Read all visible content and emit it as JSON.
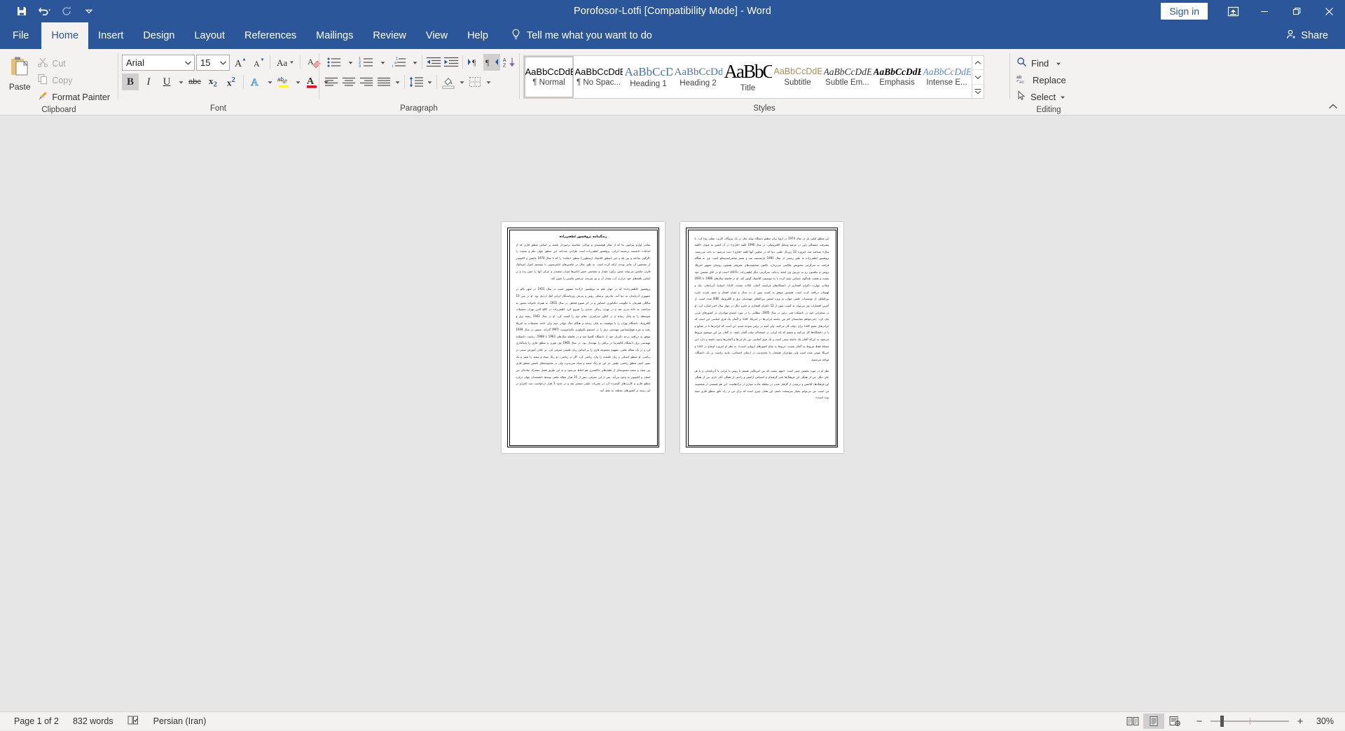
{
  "window": {
    "title": "Porofosor-Lotfi [Compatibility Mode]  -  Word",
    "sign_in": "Sign in"
  },
  "quick_access": {
    "save": "Save",
    "undo": "Undo",
    "redo": "Redo",
    "customize": "Customize Quick Access Toolbar"
  },
  "tabs": [
    {
      "label": "File",
      "active": false
    },
    {
      "label": "Home",
      "active": true
    },
    {
      "label": "Insert",
      "active": false
    },
    {
      "label": "Design",
      "active": false
    },
    {
      "label": "Layout",
      "active": false
    },
    {
      "label": "References",
      "active": false
    },
    {
      "label": "Mailings",
      "active": false
    },
    {
      "label": "Review",
      "active": false
    },
    {
      "label": "View",
      "active": false
    },
    {
      "label": "Help",
      "active": false
    }
  ],
  "tell_me": "Tell me what you want to do",
  "share": "Share",
  "ribbon": {
    "clipboard": {
      "label": "Clipboard",
      "paste": "Paste",
      "cut": "Cut",
      "copy": "Copy",
      "format_painter": "Format Painter"
    },
    "font": {
      "label": "Font",
      "font_name": "Arial",
      "font_size": "15",
      "grow_font": "Grow Font",
      "shrink_font": "Shrink Font",
      "change_case": "Change Case",
      "clear_formatting": "Clear All Formatting",
      "bold": "B",
      "italic": "I",
      "underline": "U",
      "strikethrough": "abc",
      "subscript": "x₂",
      "superscript": "x²",
      "text_effects": "Text Effects and Typography",
      "highlight": "Text Highlight Color",
      "font_color": "Font Color"
    },
    "paragraph": {
      "label": "Paragraph",
      "bullets": "Bullets",
      "numbering": "Numbering",
      "multilevel": "Multilevel List",
      "decrease_indent": "Decrease Indent",
      "increase_indent": "Increase Indent",
      "ltr": "Left-to-Right Text Direction",
      "rtl": "Right-to-Left Text Direction",
      "sort": "Sort",
      "show_marks": "Show/Hide ¶",
      "align_left": "Align Left",
      "align_center": "Center",
      "align_right": "Align Right",
      "justify": "Justify",
      "line_spacing": "Line and Paragraph Spacing",
      "shading": "Shading",
      "borders": "Borders"
    },
    "styles": {
      "label": "Styles",
      "items": [
        {
          "preview": "AaBbCcDdEe",
          "name": "¶ Normal",
          "selected": true
        },
        {
          "preview": "AaBbCcDdEe",
          "name": "¶ No Spac...",
          "selected": false
        },
        {
          "preview": "AaBbCcDdEe",
          "name": "Heading 1",
          "selected": false
        },
        {
          "preview": "AaBbCcDdEe",
          "name": "Heading 2",
          "selected": false
        },
        {
          "preview": "AaBbCcDdEe",
          "name": "Title",
          "selected": false
        },
        {
          "preview": "AaBbCcDdEe",
          "name": "Subtitle",
          "selected": false
        },
        {
          "preview": "AaBbCcDdEe",
          "name": "Subtle Em...",
          "selected": false
        },
        {
          "preview": "AaBbCcDdEe",
          "name": "Emphasis",
          "selected": false
        },
        {
          "preview": "AaBbCcDdEe",
          "name": "Intense E...",
          "selected": false
        }
      ]
    },
    "editing": {
      "label": "Editing",
      "find": "Find",
      "replace": "Replace",
      "select": "Select"
    }
  },
  "document": {
    "page1": {
      "title": "زندگینامه پروفسور لطفی‌زاده",
      "paragraphs": [
        "تمامی لوازم پیرامون ما که از تفکر هوشمندی و توانایی محاسبه برخوردار باشند بر اساس منطق فازی که از ابداعات دانشمند برجسته ایرانی، پروفسور لطفی‌زاده است طراحی شده‌اند. این منطق جهان علم و صنعت را دگرگون ساخته و بین بله و خیر (منطق کلاسیک ارسطویی) منطق «شاید» را که تا سال 1970 ماشین و کامپیوتر از تشخیص آن عاجز بودند، ارائه کرده است. به طور مثال در ماشین‌های لباس‌شویی با سیستم کنترل اتوماتیک فازی، ماشین می‌تواند ضمن برآورد مقدار و تشخیص جنس لباس‌ها میزان سفیدی و چرکی آنها را حس زده و بر اساس یافته‌های خود حرارت آب، مقدار آن و نیز سرعت چرخش ماشین را تعیین کند.",
        "پروفسور «لطفی‌زاده» که در جهان علم به پروفسور «زاده» مشهور است در سال 1921 در شهر باکو در جمهوری آذربایجان به دنیا آمد. مادرش پزشکی روس و پدرش روزنامه‌نگار ایرانی اهل اردبیل بود. او در سن 10 سالگی همزمان با حکومت دیکتاتوری استالین و در اثر شیوع قحطی در سال 1931، به همراه خانواده مجبور به مراجعت به خانه پدری شد و در تهران زندگی جدیدی را شروع کرد. لطفی‌زاده در کالج البرز تهران تحصیلات متوسطه را به پایان رساند و در کنکور سراسری، مقام دوم را کسب کرد. او در سال 1942 رشته برق و الکترونیک دانشگاه تهران را با موفقیت به پایان رساند و هنگام جنگ جهانی دوم برای ادامه تحصیلات به امریکا رفت و دوره فوق‌لیسانس مهندسی برق را در انستیتو تکنولوژی ماساچوست (MIT) گذراند. سپس در سال 1949 موفق به دریافت درجه دکترای خود از دانشگاه کلمبیا شد و در فاصله سال‌های 1963 تا 1968، ریاست دانشکده مهندسی برق دانشگاه کالیفرنیا در برکلی را عهده‌دار بود. در سال 1965 وی تئوری و منطق فازی را پایه‌گذاری کرد و در یک مقاله علمی، مفهوم مجموعه فازی را بر اساس زبان طبیعی معرفی کرد. بر خلاف آموزش سنتی در ریاضی، او منطق انسانی و زبان طبیعت را وارد ریاضی کرد. اگر در ریاضی، دو رنگ سیاه و سفید را صفر و یک تصور کنیم، منطق ریاضی، طیفی جز این دو رنگ سفید و سیاه نمی‌پذیرد، ولی در مجموعه‌های نامعین منطق فازی بین سیاه و سفید مجموعه‌ای از طیف‌های خاکستری هم لحاظ می‌شود و به این طریق فصل مشترک ساده‌ای بین انسان و کامپیوتر به وجود می‌آید. پس از این معرفی، بیش از 15 هزار مقاله علمی توسط دانشمندان جهان درباره منطق فازی و کاربردهای گسترده آن، در نشریات علمی منتشر شد و در حدود 3 هزار درخواست ثبت اختراع در این زمینه در کشورهای مختلف به عمل آمد."
      ]
    },
    "page2": {
      "paragraphs": [
        "این منطق اولین بار در سال 1974 در اروپا برای تنظیم دستگاه تولید بخار در یک نیروگاه، کاربرد عملی پیدا کرد. با پیشرفت چشمگیر ژاپن در عرصه وسایل الکترونیکی، در سال 1990 کلمه «فازی» در آن کشور به عنوان «کلمه سال» شناخته شد. امروزه 12 ژورنال علمی دنیا که در عناوین آنها کلمه «فازی» دیده می‌شود به چاپ می‌رسند. پروفسور لطفی‌زاده به طور رسمی از سال 1991 بازنشسته شد و مقیم سانفرانسیسکو است. وی به هنگام فراغت به سرگرمی محبوبش عکاسی می‌پردازد. تاکنون شخصیت‌های معروفی همچون روسای جمهور امریکا، ترومن و نیکسون رو به دوربین وی لبخند زده‌اند. سرگرمی دیگر لطفی‌زاده «Hi-Fi» است او در اتاق نشیمن خود بیست و هشت بلندگوی حساس تعبیه کرده تا به موسیقی کلاسیک گوش کند. او در فاصله سال‌های 1986 تا 2001 میلادی چهارده دکترای افتخاری از دانشگاه‌های فرانسه، آلمان، ایالات متحده، کانادا، اسپانیا، آذربایجان، چک و لهستان دریافت کرده است. همچنین موفق به کسب بیش از ده مدال و نشان افتخار و حدود پانزده جایزه بین‌المللی از موسسات علمی جهان، به ویژه انجمن بین‌المللی مهندسان برق و الکترونیک IEEE شده است. از آخرین افتخارات وی می‌توان به کسب بیش از 12 دکترای افتخاری و جایزه دیگر در چهار سال اخیر اشاره کرد. او در سخنرانی خود در دانشکده فنی برلین در سال 2005، مطالبی را در مورد اوضاع مهاجران در کشورهای عربی بیان کرد: «می‌خواهم مقایسه‌ای کم بین جامعه ایرانی‌ها در امریکا، کانادا و آلمان یک فرق اساسی این است که ایرانی‌های مقیم کانادا برای دولت کار می‌کنند. ولی آنچه در برلین متوجه شدم، این است که ایرانی‌ها یا در صنایع و یا در دانشگاه‌ها کار می‌کنند و تعمیم که یک ایرانی در استخدام دولت آلمان باشد. به گمان من این موضوع مربوط می‌شود به این‌که آلمان یک جامعه سنتی است و یک فرق اساسی بین خارجی‌ها و آلمانی‌ها وجود داشته و دارد. این مسئله فقط مربوط به آلمان نیست، مربوط به تمام کشورهای اروپایی است». به نظر او امروزه اوضاع در کانادا و امریکا عوض شده است ولی مهاجران همچنان با محدودیت در ارتقای اجتماعی، مانند ریاست بر یک دانشگاه، مواجه می‌شوند.",
        "نظر او در مورد ملیتش چنین است: «مهم نیست که من امریکایی هستم یا روس یا ایرانی یا آذربایجانی و یا هر جای دیگر. من از همگی این فرهنگ‌ها تاثیر گرفته‌ام و احساس آرامش و راحتی از همگی آنان دارم. من از همگی این فرهنگ‌ها، کلامش و ترمیدن از گرفتار شدن در سلطه عادت سپاری از ترک‌هاست. این هم قسمتی از شخصیت من است. من می‌توانم بسیار سرسخت باشم. این همان چیزی است که برای من در راه خلق منطق فازی مفید بوده است»."
      ]
    }
  },
  "status_bar": {
    "page": "Page 1 of 2",
    "words": "832 words",
    "proofing": "Proofing errors",
    "language": "Persian (Iran)",
    "read_mode": "Read Mode",
    "print_layout": "Print Layout",
    "web_layout": "Web Layout",
    "zoom_out": "Zoom Out",
    "zoom_in": "Zoom In",
    "zoom_level": "30%"
  }
}
